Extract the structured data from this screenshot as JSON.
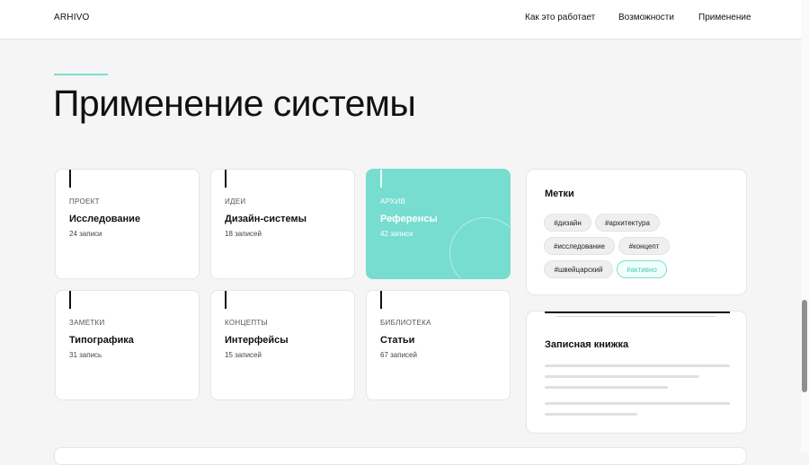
{
  "header": {
    "brand": "ARHIVO",
    "nav": [
      "Как это работает",
      "Возможности",
      "Применение"
    ]
  },
  "section": {
    "title": "Применение системы"
  },
  "cards": [
    {
      "category": "ПРОЕКТ",
      "name": "Исследование",
      "count": "24 записи",
      "active": false
    },
    {
      "category": "ИДЕИ",
      "name": "Дизайн-системы",
      "count": "18 записей",
      "active": false
    },
    {
      "category": "АРХИВ",
      "name": "Референсы",
      "count": "42 записи",
      "active": true
    },
    {
      "category": "ЗАМЕТКИ",
      "name": "Типографика",
      "count": "31 запись",
      "active": false
    },
    {
      "category": "КОНЦЕПТЫ",
      "name": "Интерфейсы",
      "count": "15 записей",
      "active": false
    },
    {
      "category": "БИБЛИОТЕКА",
      "name": "Статьи",
      "count": "67 записей",
      "active": false
    }
  ],
  "tags_panel": {
    "title": "Метки",
    "tags": [
      "#дизайн",
      "#архитектура",
      "#исследование",
      "#концепт",
      "#швейцарский",
      "#активно"
    ],
    "active_tag": "#активно"
  },
  "notebook_panel": {
    "title": "Записная книжка"
  },
  "colors": {
    "accent": "#76ddd0",
    "background": "#f5f5f5",
    "text": "#111111"
  }
}
